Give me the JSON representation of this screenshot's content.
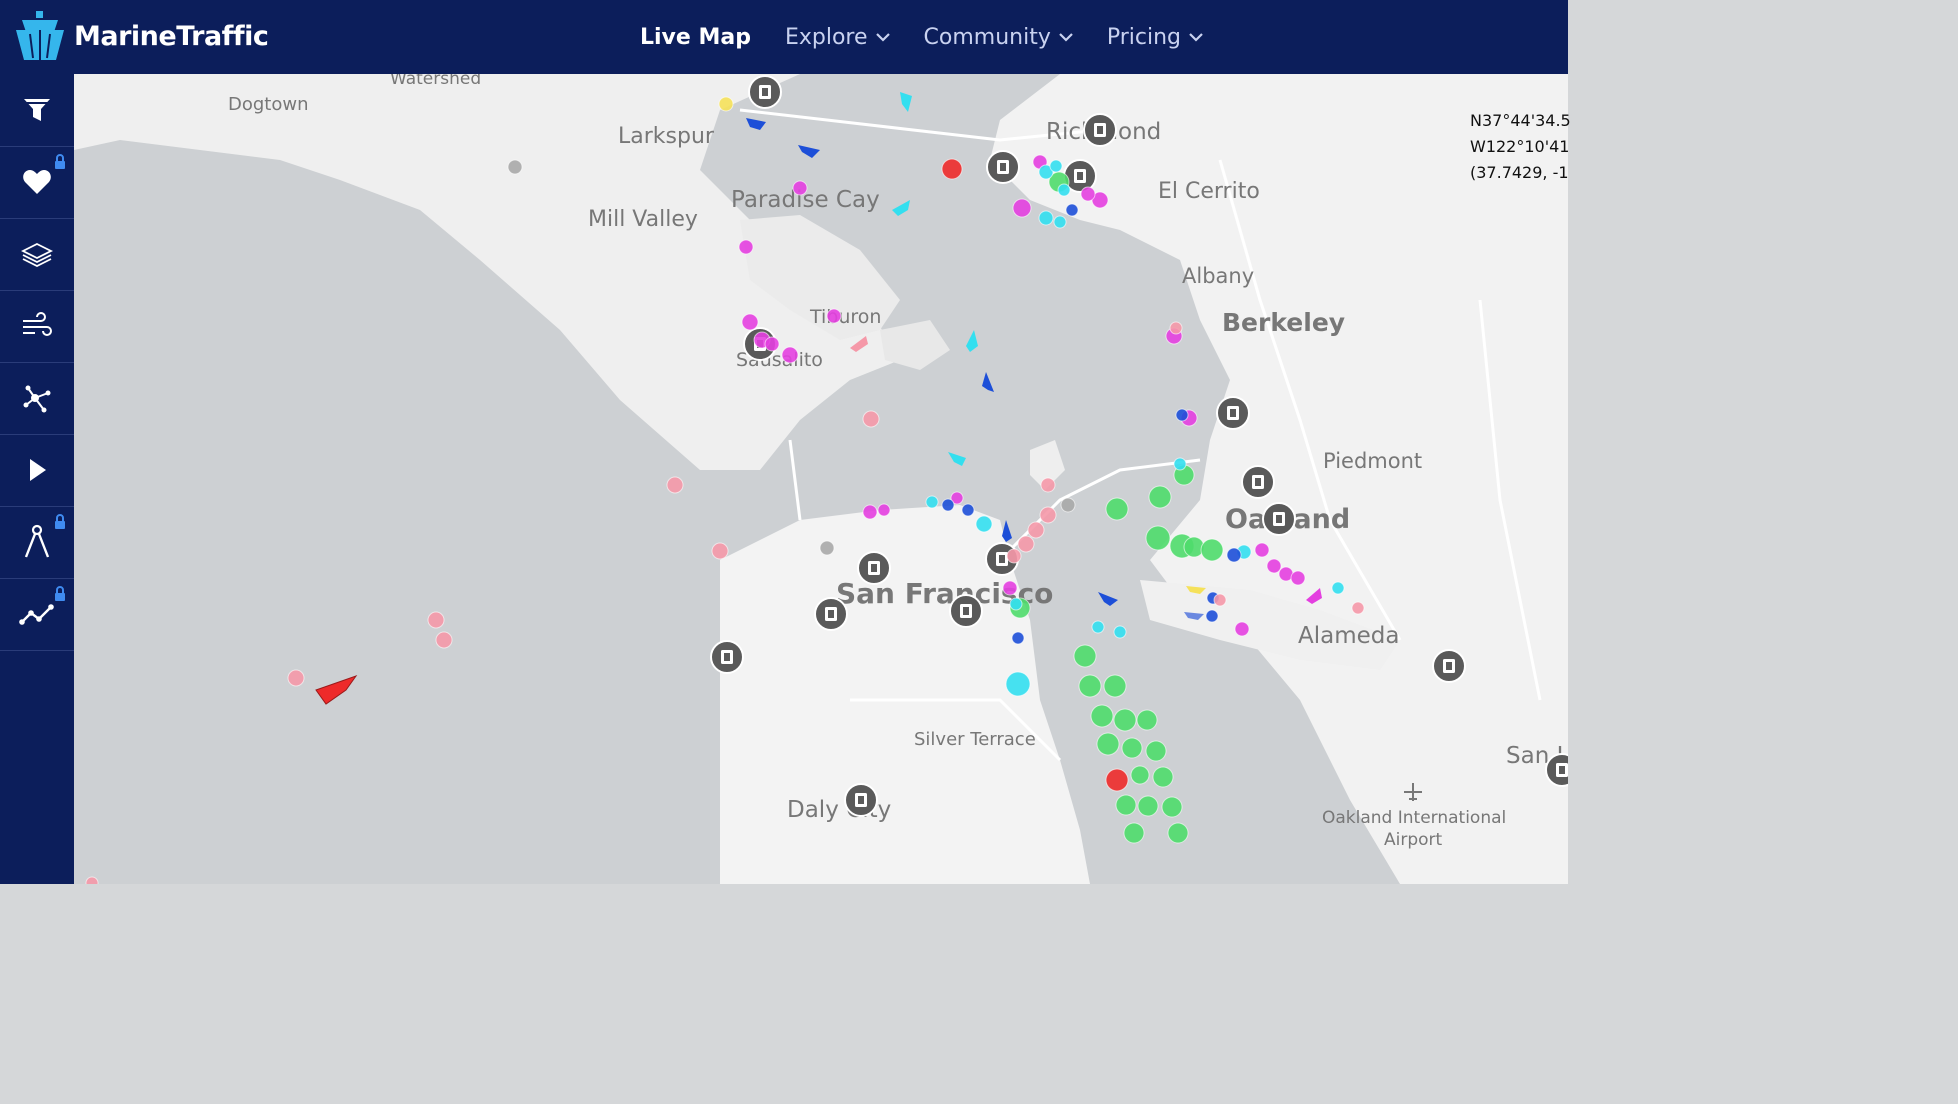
{
  "app": {
    "brand": "MarineTraffic",
    "colors": {
      "navy": "#0c1e5b",
      "water": "#cdd0d3",
      "land": "#f1f1f1"
    }
  },
  "nav": {
    "items": [
      {
        "label": "Live Map",
        "active": true,
        "has_dropdown": false
      },
      {
        "label": "Explore",
        "active": false,
        "has_dropdown": true
      },
      {
        "label": "Community",
        "active": false,
        "has_dropdown": true
      },
      {
        "label": "Pricing",
        "active": false,
        "has_dropdown": true
      }
    ]
  },
  "sidebar": {
    "items": [
      {
        "icon": "filter-icon",
        "locked": false
      },
      {
        "icon": "heart-icon",
        "locked": true
      },
      {
        "icon": "layers-icon",
        "locked": false
      },
      {
        "icon": "wind-icon",
        "locked": false
      },
      {
        "icon": "network-icon",
        "locked": false
      },
      {
        "icon": "play-icon",
        "locked": false
      },
      {
        "icon": "measure-icon",
        "locked": true
      },
      {
        "icon": "route-icon",
        "locked": true
      }
    ]
  },
  "coordinates": {
    "lat": "N37°44'34.5",
    "lon": "W122°10'41",
    "decimal": "(37.7429, -1"
  },
  "map": {
    "labels": {
      "watershed": "Watershed",
      "dogtown": "Dogtown",
      "larkspur": "Larkspur",
      "paradise_cay": "Paradise Cay",
      "mill_valley": "Mill Valley",
      "richmond": "Richmond",
      "el_cerrito": "El Cerrito",
      "albany": "Albany",
      "berkeley": "Berkeley",
      "tiburon": "Tiburon",
      "sausalito": "Sausalito",
      "piedmont": "Piedmont",
      "oakland": "Oakland",
      "san_francisco": "San Francisco",
      "alameda": "Alameda",
      "silver_terrace": "Silver Terrace",
      "san_leandro": "San Lea",
      "daly_city": "Daly City",
      "oakland_airport_1": "Oakland International",
      "oakland_airport_2": "Airport"
    },
    "vessel_colors": {
      "green": "#4fdc6c",
      "magenta": "#e43fe0",
      "cyan": "#33dfef",
      "blue": "#1d4fd8",
      "pink": "#f598a8",
      "red": "#ee2a2a",
      "yellow": "#f5e15a",
      "gray": "#a8a8a8"
    }
  }
}
